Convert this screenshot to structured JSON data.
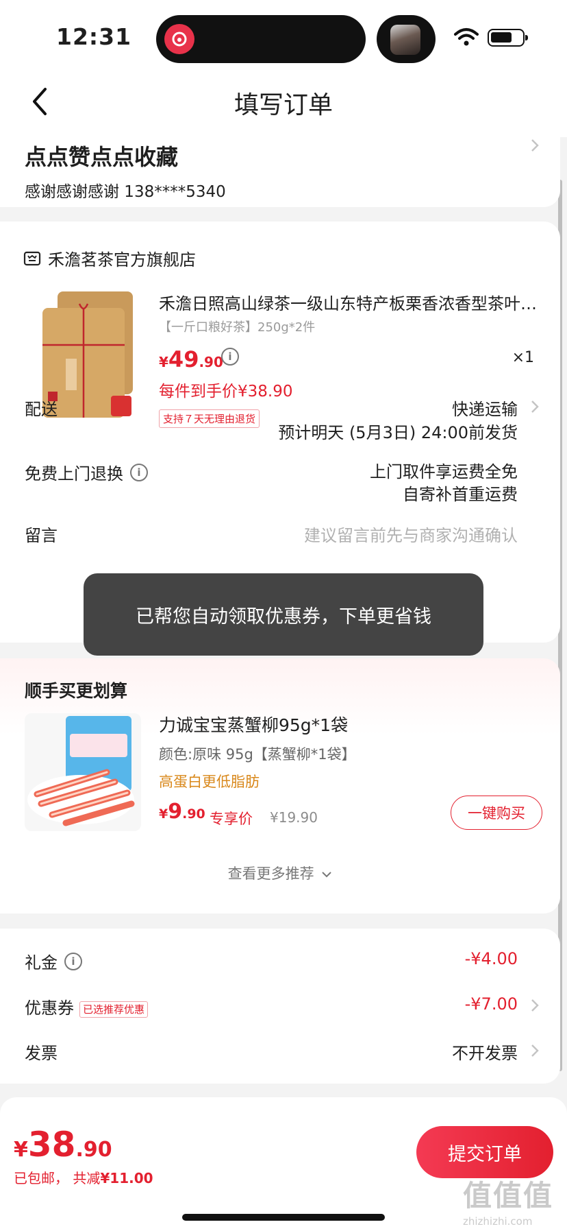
{
  "status": {
    "time": "12:31",
    "island_app_icon": "netease-music-icon",
    "avatar_icon": "avatar-icon"
  },
  "nav": {
    "title": "填写订单",
    "back_icon": "chevron-left-icon"
  },
  "address": {
    "name": "点点赞点点收藏",
    "contact": "感谢感谢感谢  138****5340"
  },
  "order": {
    "shop_name": "禾澹茗茶官方旗舰店",
    "product": {
      "title": "禾澹日照高山绿茶一级山东特产板栗香浓香型茶叶自己喝",
      "spec": "【一斤口粮好茶】250g*2件",
      "price_currency": "¥",
      "price_int": "49",
      "price_dec": ".90",
      "quantity": "×1",
      "unit_price": "每件到手价¥38.90",
      "return_tag": "支持７天无理由退货"
    },
    "delivery": {
      "label": "配送",
      "value": "快递运输",
      "eta": "预计明天 (5月3日) 24:00前发货"
    },
    "free_return": {
      "label": "免费上门退换",
      "line1": "上门取件享运费全免",
      "line2": "自寄补首重运费"
    },
    "message": {
      "label": "留言",
      "placeholder": "建议留言前先与商家沟通确认"
    }
  },
  "toast": {
    "text": "已帮您自动领取优惠券，下单更省钱"
  },
  "recommend": {
    "title": "顺手买更划算",
    "item": {
      "name": "力诚宝宝蒸蟹柳95g*1袋",
      "spec": "颜色:原味 95g【蒸蟹柳*1袋】",
      "tag": "高蛋白更低脂肪",
      "price_currency": "¥",
      "price_int": "9",
      "price_dec": ".90",
      "exclusive_label": "专享价",
      "original_price": "¥19.90",
      "buy_label": "一键购买"
    },
    "more_label": "查看更多推荐"
  },
  "fees": {
    "gift": {
      "label": "礼金",
      "value": "-¥4.00"
    },
    "coupon": {
      "label": "优惠券",
      "tag": "已选推荐优惠",
      "value": "-¥7.00"
    },
    "invoice": {
      "label": "发票",
      "value": "不开发票"
    }
  },
  "footer": {
    "total_currency": "¥",
    "total_int": "38",
    "total_dec": ".90",
    "shipping_note": "已包邮，",
    "saved_prefix": "共减",
    "saved_amount": "¥11.00",
    "submit_label": "提交订单",
    "watermark": "值值值",
    "watermark_sub": "zhizhizhi.com"
  },
  "colors": {
    "accent": "#e3202f",
    "tag_orange": "#d9881b"
  }
}
